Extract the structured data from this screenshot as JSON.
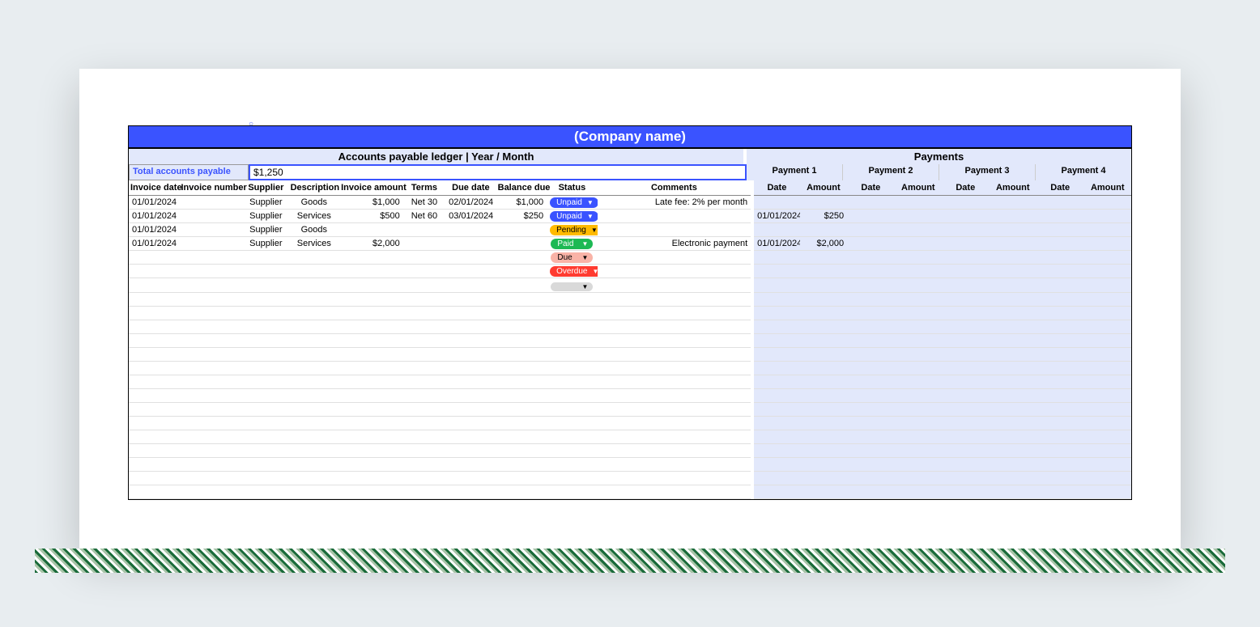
{
  "company_name": "(Company name)",
  "ledger_title": "Accounts payable ledger | Year / Month",
  "payments_title": "Payments",
  "total_label": "Total accounts payable",
  "total_value": "$1,250",
  "payment_groups": [
    "Payment 1",
    "Payment 2",
    "Payment 3",
    "Payment 4"
  ],
  "columns": {
    "invoice_date": "Invoice date",
    "invoice_number": "Invoice number",
    "supplier": "Supplier",
    "description": "Description",
    "invoice_amount": "Invoice amount",
    "terms": "Terms",
    "due_date": "Due date",
    "balance_due": "Balance due",
    "status": "Status",
    "comments": "Comments",
    "date": "Date",
    "amount": "Amount"
  },
  "status_labels": {
    "unpaid": "Unpaid",
    "pending": "Pending",
    "paid": "Paid",
    "due": "Due",
    "overdue": "Overdue",
    "blank": ""
  },
  "rows": [
    {
      "invoice_date": "01/01/2024",
      "supplier": "Supplier",
      "description": "Goods",
      "invoice_amount": "$1,000",
      "terms": "Net 30",
      "due_date": "02/01/2024",
      "balance_due": "$1,000",
      "status": "unpaid",
      "status_color": "blue",
      "comments": "Late fee: 2% per month",
      "p1_date": "",
      "p1_amount": ""
    },
    {
      "invoice_date": "01/01/2024",
      "supplier": "Supplier",
      "description": "Services",
      "invoice_amount": "$500",
      "terms": "Net 60",
      "due_date": "03/01/2024",
      "balance_due": "$250",
      "status": "unpaid",
      "status_color": "blue",
      "comments": "",
      "p1_date": "01/01/2024",
      "p1_amount": "$250"
    },
    {
      "invoice_date": "01/01/2024",
      "supplier": "Supplier",
      "description": "Goods",
      "invoice_amount": "",
      "terms": "",
      "due_date": "",
      "balance_due": "",
      "status": "pending",
      "status_color": "orange",
      "comments": "",
      "p1_date": "",
      "p1_amount": ""
    },
    {
      "invoice_date": "01/01/2024",
      "supplier": "Supplier",
      "description": "Services",
      "invoice_amount": "$2,000",
      "terms": "",
      "due_date": "",
      "balance_due": "",
      "status": "paid",
      "status_color": "green",
      "comments": "Electronic payment",
      "p1_date": "01/01/2024",
      "p1_amount": "$2,000"
    },
    {
      "invoice_date": "",
      "supplier": "",
      "description": "",
      "invoice_amount": "",
      "terms": "",
      "due_date": "",
      "balance_due": "",
      "status": "due",
      "status_color": "pink",
      "comments": "",
      "p1_date": "",
      "p1_amount": ""
    },
    {
      "invoice_date": "",
      "supplier": "",
      "description": "",
      "invoice_amount": "",
      "terms": "",
      "due_date": "",
      "balance_due": "",
      "status": "overdue",
      "status_color": "red",
      "comments": "",
      "p1_date": "",
      "p1_amount": ""
    },
    {
      "invoice_date": "",
      "supplier": "",
      "description": "",
      "invoice_amount": "",
      "terms": "",
      "due_date": "",
      "balance_due": "",
      "status": "blank",
      "status_color": "grey",
      "comments": "",
      "p1_date": "",
      "p1_amount": ""
    }
  ]
}
